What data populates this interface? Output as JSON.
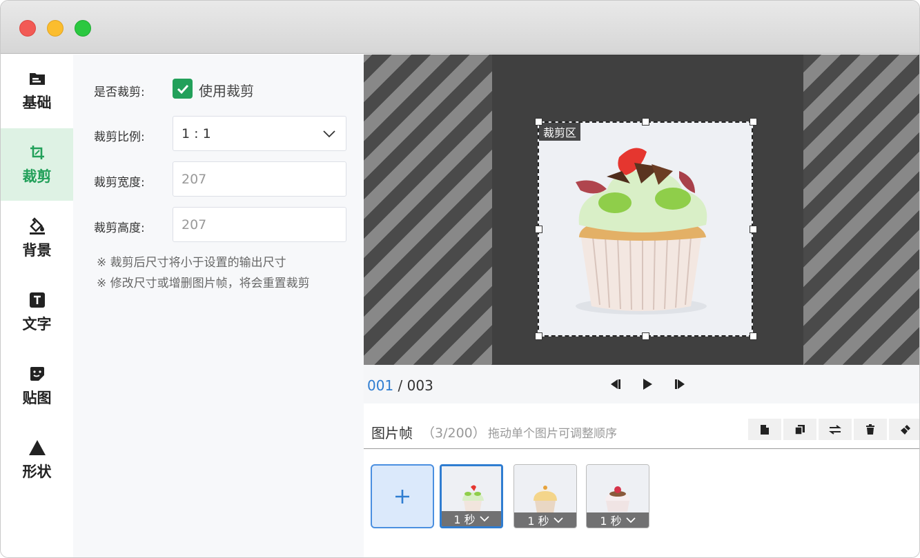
{
  "sidebar": {
    "items": [
      {
        "label": "基础"
      },
      {
        "label": "裁剪"
      },
      {
        "label": "背景"
      },
      {
        "label": "文字"
      },
      {
        "label": "贴图"
      },
      {
        "label": "形状"
      }
    ],
    "active_index": 1,
    "accent": "#22a05a"
  },
  "settings": {
    "crop_toggle_label": "是否裁剪:",
    "use_crop_label": "使用裁剪",
    "use_crop_checked": true,
    "ratio_label": "裁剪比例:",
    "ratio_value": "1 : 1",
    "width_label": "裁剪宽度:",
    "width_value": "207",
    "height_label": "裁剪高度:",
    "height_value": "207",
    "notes": [
      "※ 裁剪后尺寸将小于设置的输出尺寸",
      "※ 修改尺寸或增删图片帧，将会重置裁剪"
    ]
  },
  "preview": {
    "crop_area_label": "裁剪区"
  },
  "playback": {
    "current": "001",
    "separator": " / ",
    "total": "003"
  },
  "frames": {
    "title": "图片帧",
    "count": "（3/200）",
    "hint": "拖动单个图片可调整顺序",
    "items": [
      {
        "duration": "1 秒"
      },
      {
        "duration": "1 秒"
      },
      {
        "duration": "1 秒"
      }
    ],
    "selected_index": 0
  },
  "colors": {
    "accent_green": "#22a05a",
    "accent_blue": "#2f7dd1"
  }
}
